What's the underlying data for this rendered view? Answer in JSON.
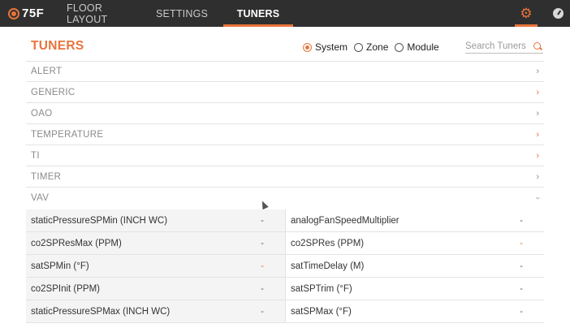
{
  "app": {
    "logo_text": "75F"
  },
  "nav": {
    "floor_layout": "FLOOR LAYOUT",
    "settings": "SETTINGS",
    "tuners": "TUNERS",
    "gear_icon": "gear-icon",
    "gauge_icon": "gauge-icon"
  },
  "page": {
    "title": "TUNERS"
  },
  "scope": {
    "options": [
      "System",
      "Zone",
      "Module"
    ],
    "selected": "System"
  },
  "search": {
    "placeholder": "Search Tuners",
    "value": ""
  },
  "categories": [
    {
      "label": "ALERT",
      "expanded": false
    },
    {
      "label": "GENERIC",
      "expanded": false
    },
    {
      "label": "OAO",
      "expanded": false
    },
    {
      "label": "TEMPERATURE",
      "expanded": false
    },
    {
      "label": "TI",
      "expanded": false
    },
    {
      "label": "TIMER",
      "expanded": false
    },
    {
      "label": "VAV",
      "expanded": true
    }
  ],
  "vav_tuners": {
    "left": [
      {
        "label": "staticPressureSPMin (INCH WC)",
        "value": "-"
      },
      {
        "label": "co2SPResMax (PPM)",
        "value": "-"
      },
      {
        "label": "satSPMin (°F)",
        "value": "-"
      },
      {
        "label": "co2SPInit (PPM)",
        "value": "-"
      },
      {
        "label": "staticPressureSPMax (INCH WC)",
        "value": "-"
      }
    ],
    "right": [
      {
        "label": "analogFanSpeedMultiplier",
        "value": "-"
      },
      {
        "label": "co2SPRes (PPM)",
        "value": "-"
      },
      {
        "label": "satTimeDelay (M)",
        "value": "-"
      },
      {
        "label": "satSPTrim (°F)",
        "value": "-"
      },
      {
        "label": "satSPMax (°F)",
        "value": "-"
      }
    ]
  },
  "colors": {
    "accent": "#e8743b",
    "topbar": "#2f2f2f"
  }
}
